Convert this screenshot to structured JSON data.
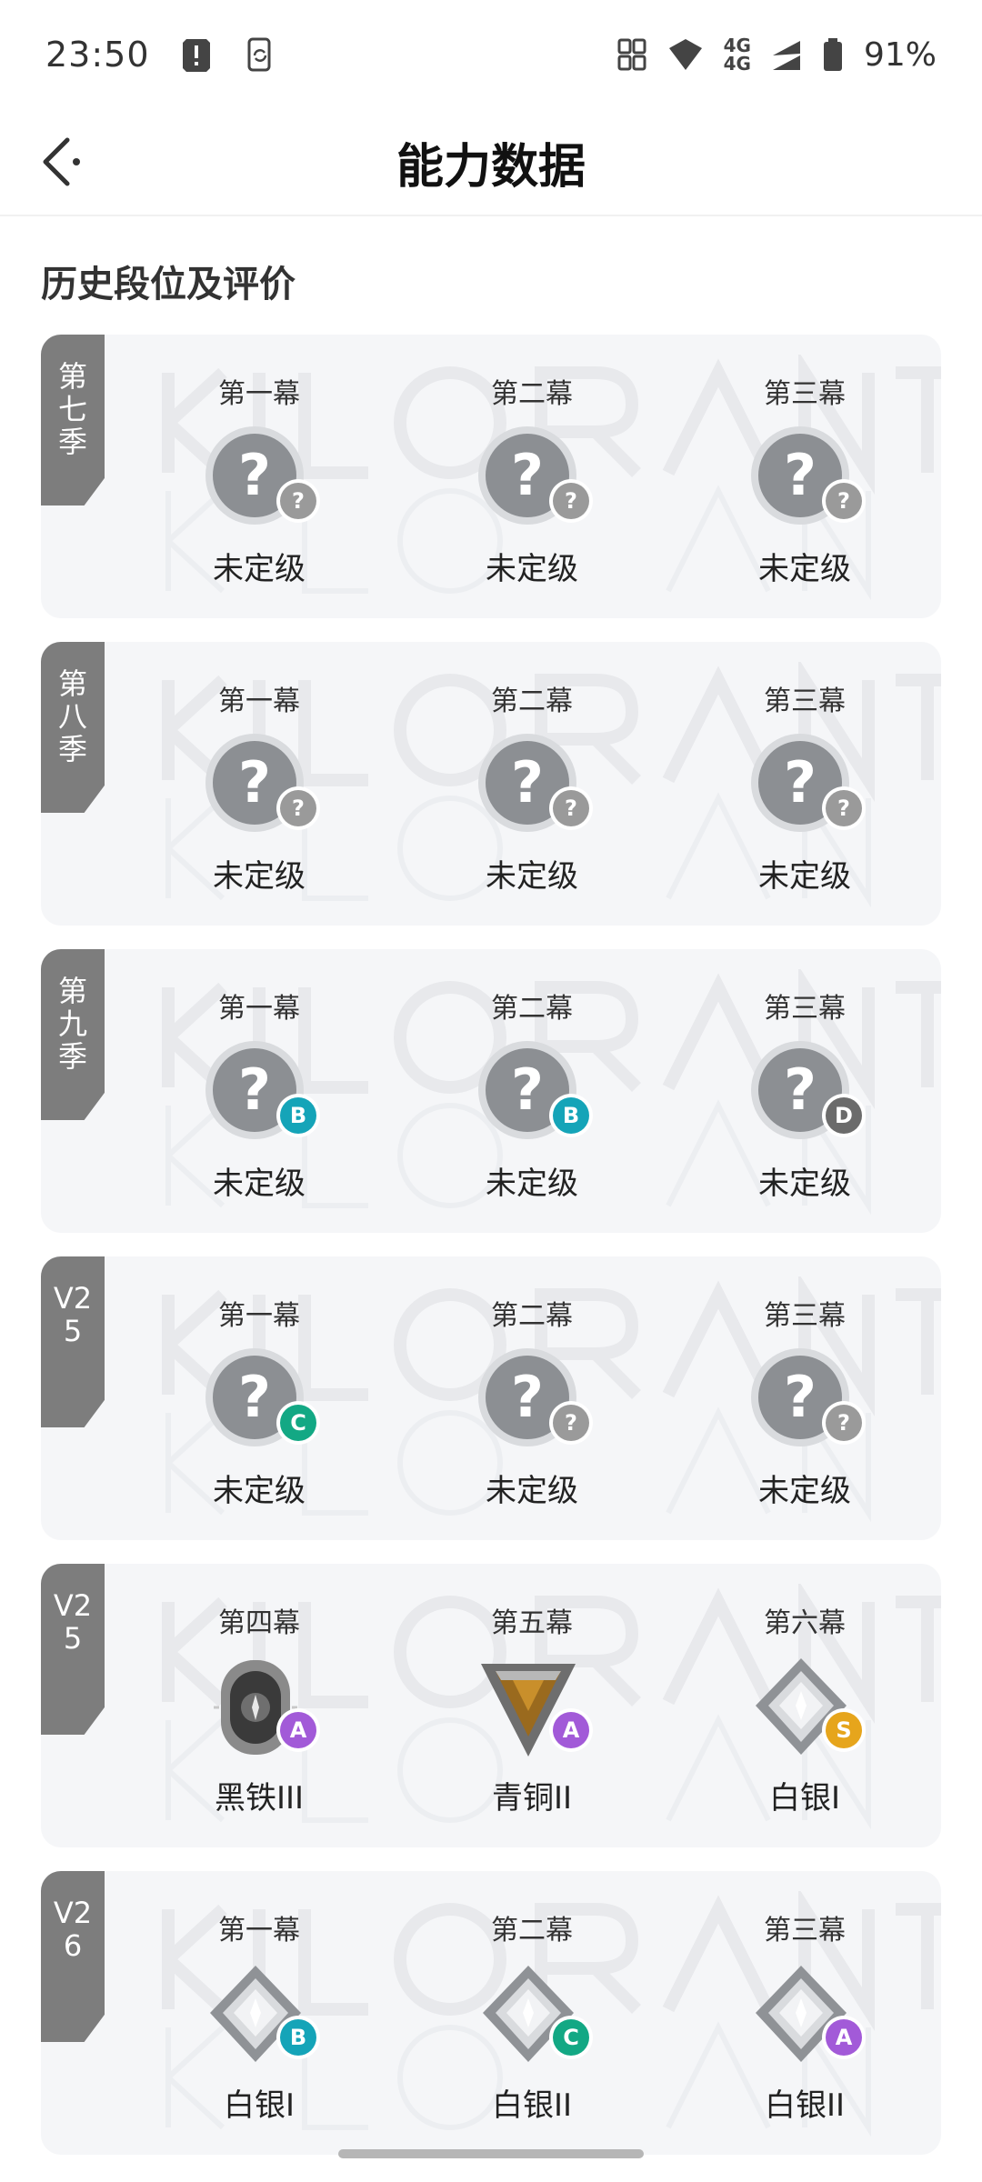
{
  "status_bar": {
    "time": "23:50",
    "network": "4G",
    "battery": "91%"
  },
  "header": {
    "title": "能力数据"
  },
  "section": {
    "title": "历史段位及评价"
  },
  "colors": {
    "tag_bg": "#7d7d7d",
    "card_bg": "#f5f6f8",
    "grade_B": "#15a4b8",
    "grade_C": "#13a884",
    "grade_D": "#6b6b6b",
    "grade_A": "#a25ad8",
    "grade_S": "#e6a51c",
    "grade_none": "#9a9a9a"
  },
  "seasons": [
    {
      "tag": "第\n七\n季",
      "acts": [
        {
          "label": "第一幕",
          "rank_name": "未定级",
          "rank_icon": "unranked-icon",
          "grade": "?"
        },
        {
          "label": "第二幕",
          "rank_name": "未定级",
          "rank_icon": "unranked-icon",
          "grade": "?"
        },
        {
          "label": "第三幕",
          "rank_name": "未定级",
          "rank_icon": "unranked-icon",
          "grade": "?"
        }
      ]
    },
    {
      "tag": "第\n八\n季",
      "acts": [
        {
          "label": "第一幕",
          "rank_name": "未定级",
          "rank_icon": "unranked-icon",
          "grade": "?"
        },
        {
          "label": "第二幕",
          "rank_name": "未定级",
          "rank_icon": "unranked-icon",
          "grade": "?"
        },
        {
          "label": "第三幕",
          "rank_name": "未定级",
          "rank_icon": "unranked-icon",
          "grade": "?"
        }
      ]
    },
    {
      "tag": "第\n九\n季",
      "acts": [
        {
          "label": "第一幕",
          "rank_name": "未定级",
          "rank_icon": "unranked-icon",
          "grade": "B"
        },
        {
          "label": "第二幕",
          "rank_name": "未定级",
          "rank_icon": "unranked-icon",
          "grade": "B"
        },
        {
          "label": "第三幕",
          "rank_name": "未定级",
          "rank_icon": "unranked-icon",
          "grade": "D"
        }
      ]
    },
    {
      "tag": "V2\n5",
      "acts": [
        {
          "label": "第一幕",
          "rank_name": "未定级",
          "rank_icon": "unranked-icon",
          "grade": "C"
        },
        {
          "label": "第二幕",
          "rank_name": "未定级",
          "rank_icon": "unranked-icon",
          "grade": "?"
        },
        {
          "label": "第三幕",
          "rank_name": "未定级",
          "rank_icon": "unranked-icon",
          "grade": "?"
        }
      ]
    },
    {
      "tag": "V2\n5",
      "acts": [
        {
          "label": "第四幕",
          "rank_name": "黑铁III",
          "rank_icon": "iron-rank-icon",
          "grade": "A"
        },
        {
          "label": "第五幕",
          "rank_name": "青铜II",
          "rank_icon": "bronze-rank-icon",
          "grade": "A"
        },
        {
          "label": "第六幕",
          "rank_name": "白银I",
          "rank_icon": "silver-rank-icon",
          "grade": "S"
        }
      ]
    },
    {
      "tag": "V2\n6",
      "acts": [
        {
          "label": "第一幕",
          "rank_name": "白银I",
          "rank_icon": "silver-rank-icon",
          "grade": "B"
        },
        {
          "label": "第二幕",
          "rank_name": "白银II",
          "rank_icon": "silver-rank-icon",
          "grade": "C"
        },
        {
          "label": "第三幕",
          "rank_name": "白银II",
          "rank_icon": "silver-rank-icon",
          "grade": "A"
        }
      ]
    }
  ]
}
